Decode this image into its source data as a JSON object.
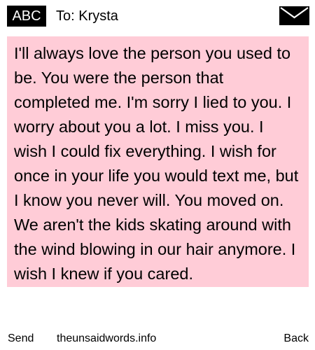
{
  "header": {
    "badge": "ABC",
    "recipient": "To: Krysta",
    "icon": "envelope-icon"
  },
  "message": {
    "text": "I'll always love the person you used to be. You were the person that completed me. I'm sorry I lied to you. I worry about you a lot. I miss you. I wish I could fix everything. I wish for once in your life you would text me, but I know you never will. You moved on. We aren't the kids skating around with the wind blowing in our hair anymore. I wish I knew if you cared."
  },
  "footer": {
    "send_label": "Send",
    "site": "theunsaidwords.info",
    "back_label": "Back"
  },
  "colors": {
    "message_background": "#ffccd7",
    "badge_background": "#000000",
    "page_background": "#ffffff"
  }
}
